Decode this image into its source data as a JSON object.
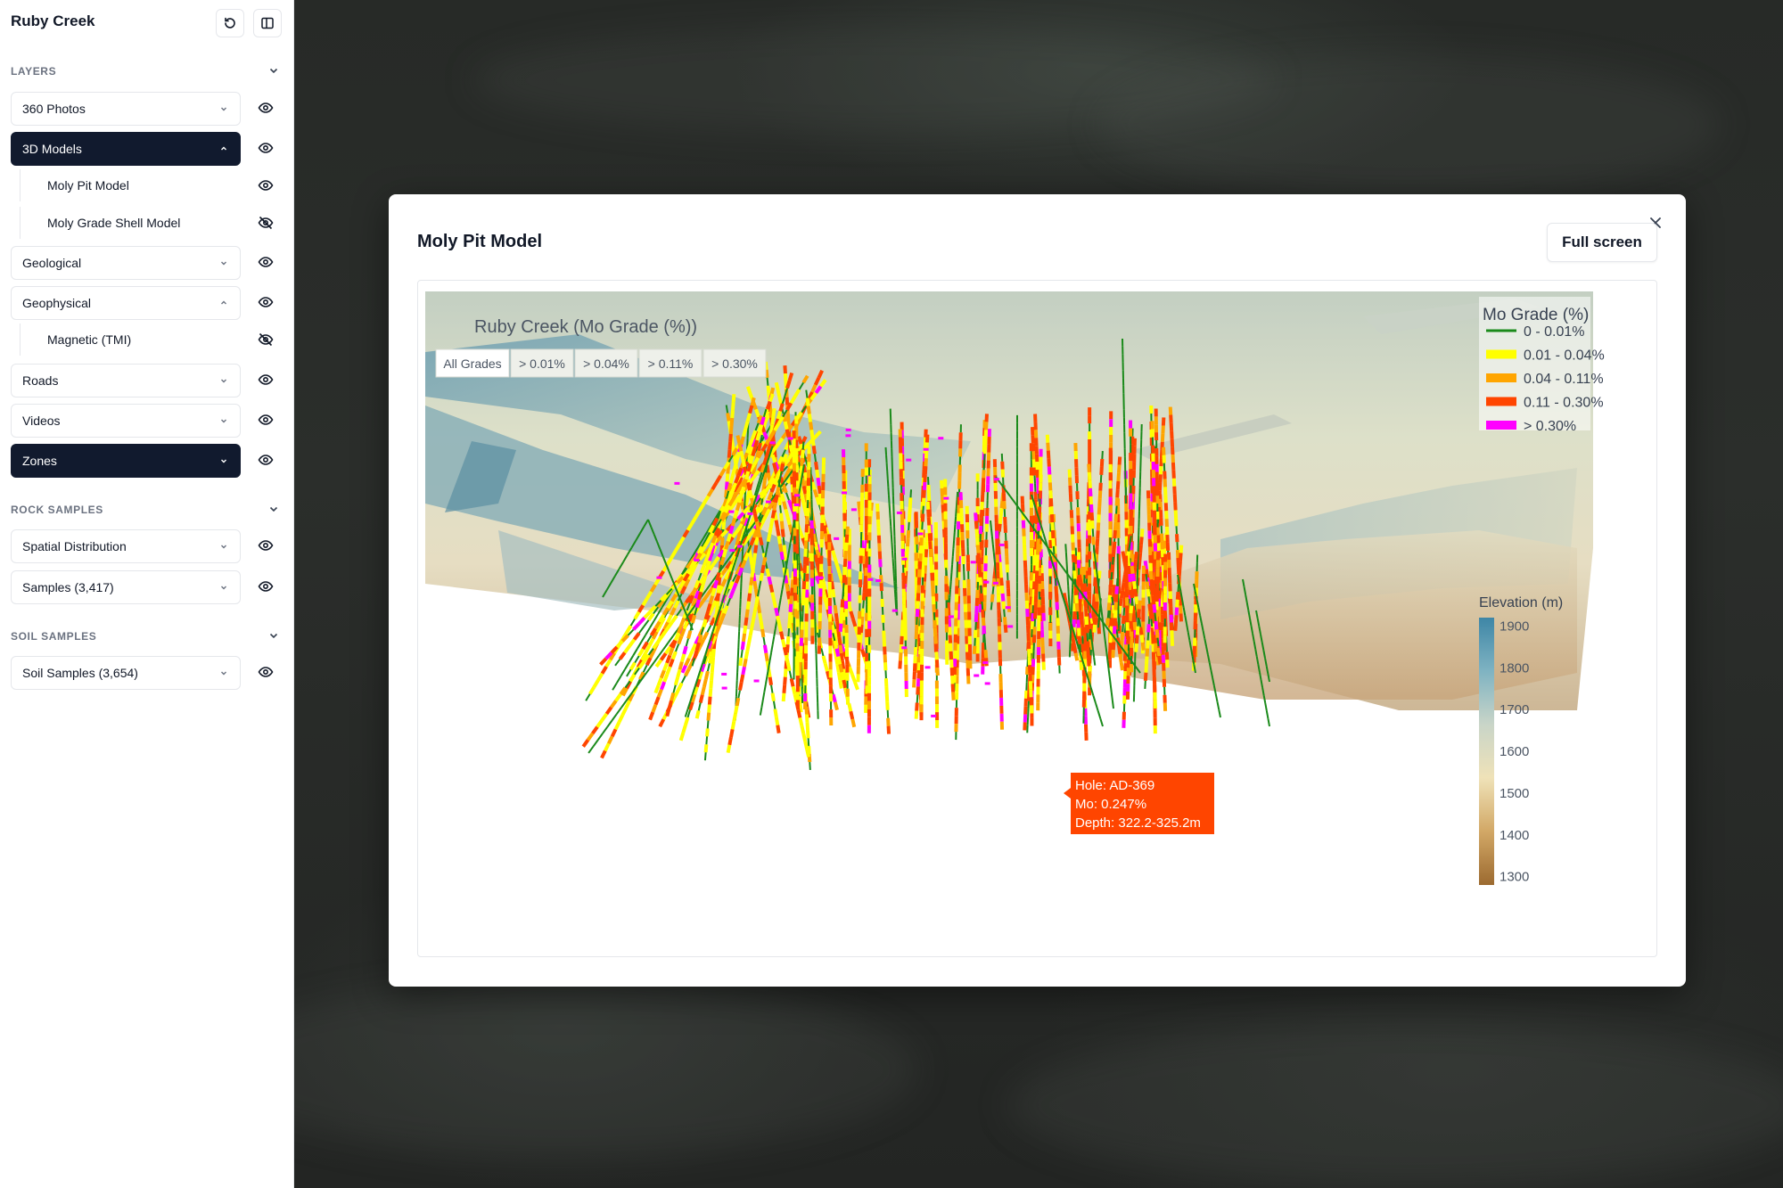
{
  "app": {
    "title": "Ruby Creek"
  },
  "sidebar": {
    "sections": [
      {
        "label": "LAYERS"
      },
      {
        "label": "ROCK SAMPLES"
      },
      {
        "label": "SOIL SAMPLES"
      }
    ],
    "layers": [
      {
        "label": "360 Photos",
        "expanded": false,
        "active": false,
        "visible": true
      },
      {
        "label": "3D Models",
        "expanded": true,
        "active": true,
        "visible": true,
        "children": [
          {
            "label": "Moly Pit Model",
            "visible": true
          },
          {
            "label": "Moly Grade Shell Model",
            "visible": false
          }
        ]
      },
      {
        "label": "Geological",
        "expanded": false,
        "active": false,
        "visible": true
      },
      {
        "label": "Geophysical",
        "expanded": true,
        "active": false,
        "visible": true,
        "children": [
          {
            "label": "Magnetic (TMI)",
            "visible": false
          }
        ]
      },
      {
        "label": "Roads",
        "expanded": false,
        "active": false,
        "visible": true
      },
      {
        "label": "Videos",
        "expanded": false,
        "active": false,
        "visible": true
      },
      {
        "label": "Zones",
        "expanded": false,
        "active": true,
        "visible": true
      }
    ],
    "rock_samples": [
      {
        "label": "Spatial Distribution",
        "visible": true
      },
      {
        "label": "Samples (3,417)",
        "visible": true
      }
    ],
    "soil_samples": [
      {
        "label": "Soil Samples (3,654)",
        "visible": true
      }
    ]
  },
  "modal": {
    "title": "Moly Pit Model",
    "full_screen_label": "Full screen"
  },
  "chart_data": {
    "type": "scatter",
    "title": "Ruby Creek (Mo Grade (%))",
    "filter_buttons": [
      "All Grades",
      "> 0.01%",
      "> 0.04%",
      "> 0.11%",
      "> 0.30%"
    ],
    "active_filter": "All Grades",
    "legend": {
      "title": "Mo Grade (%)",
      "placement": "top-right",
      "entries": [
        {
          "label": "0 - 0.01%",
          "color": "#1a8a1a"
        },
        {
          "label": "0.01 - 0.04%",
          "color": "#ffff00"
        },
        {
          "label": "0.04 - 0.11%",
          "color": "#ffa500"
        },
        {
          "label": "0.11 - 0.30%",
          "color": "#ff4500"
        },
        {
          "label": "> 0.30%",
          "color": "#ff00ff"
        }
      ]
    },
    "colorbar": {
      "title": "Elevation (m)",
      "ticks": [
        1900,
        1800,
        1700,
        1600,
        1500,
        1400,
        1300
      ],
      "range": [
        1280,
        1920
      ],
      "colors": [
        "#9c6a30",
        "#d2a866",
        "#efe2b8",
        "#c9d5c8",
        "#7fb3c2",
        "#3e86a6"
      ]
    },
    "tooltip": {
      "hole": "Hole: AD-369",
      "mo": "Mo: 0.247%",
      "depth": "Depth: 322.2-325.2m",
      "color": "#ff4500"
    }
  }
}
